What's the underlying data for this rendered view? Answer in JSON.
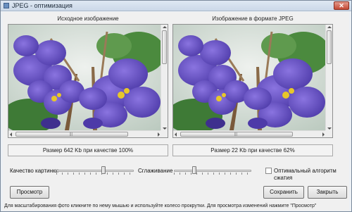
{
  "window": {
    "title": "JPEG - оптимизация",
    "close_label": "✕"
  },
  "left_panel": {
    "caption": "Исходное изображение",
    "size_text": "Размер 642 Kb при качестве 100%"
  },
  "right_panel": {
    "caption": "Изображение в формате JPEG",
    "size_text": "Размер 22 Kb при качестве 62%"
  },
  "controls": {
    "quality_label": "Качество картинки",
    "quality_value": 0.62,
    "smoothing_label": "Сглаживание",
    "smoothing_value": 0.25,
    "optimal_label": "Оптимальный алгоритм сжатия",
    "optimal_checked": false
  },
  "buttons": {
    "preview": "Просмотр",
    "save": "Сохранить",
    "close": "Закрыть"
  },
  "status_text": "Для масштабирования фото кликните по нему мышью и используйте колесо прокрутки. Для просмотра изменений нажмите \"Просмотр\"",
  "colors": {
    "petal": "#6b56c9",
    "petal_dark": "#3e2f8e",
    "leaf": "#3e7a36",
    "stamen": "#e8c72a"
  }
}
